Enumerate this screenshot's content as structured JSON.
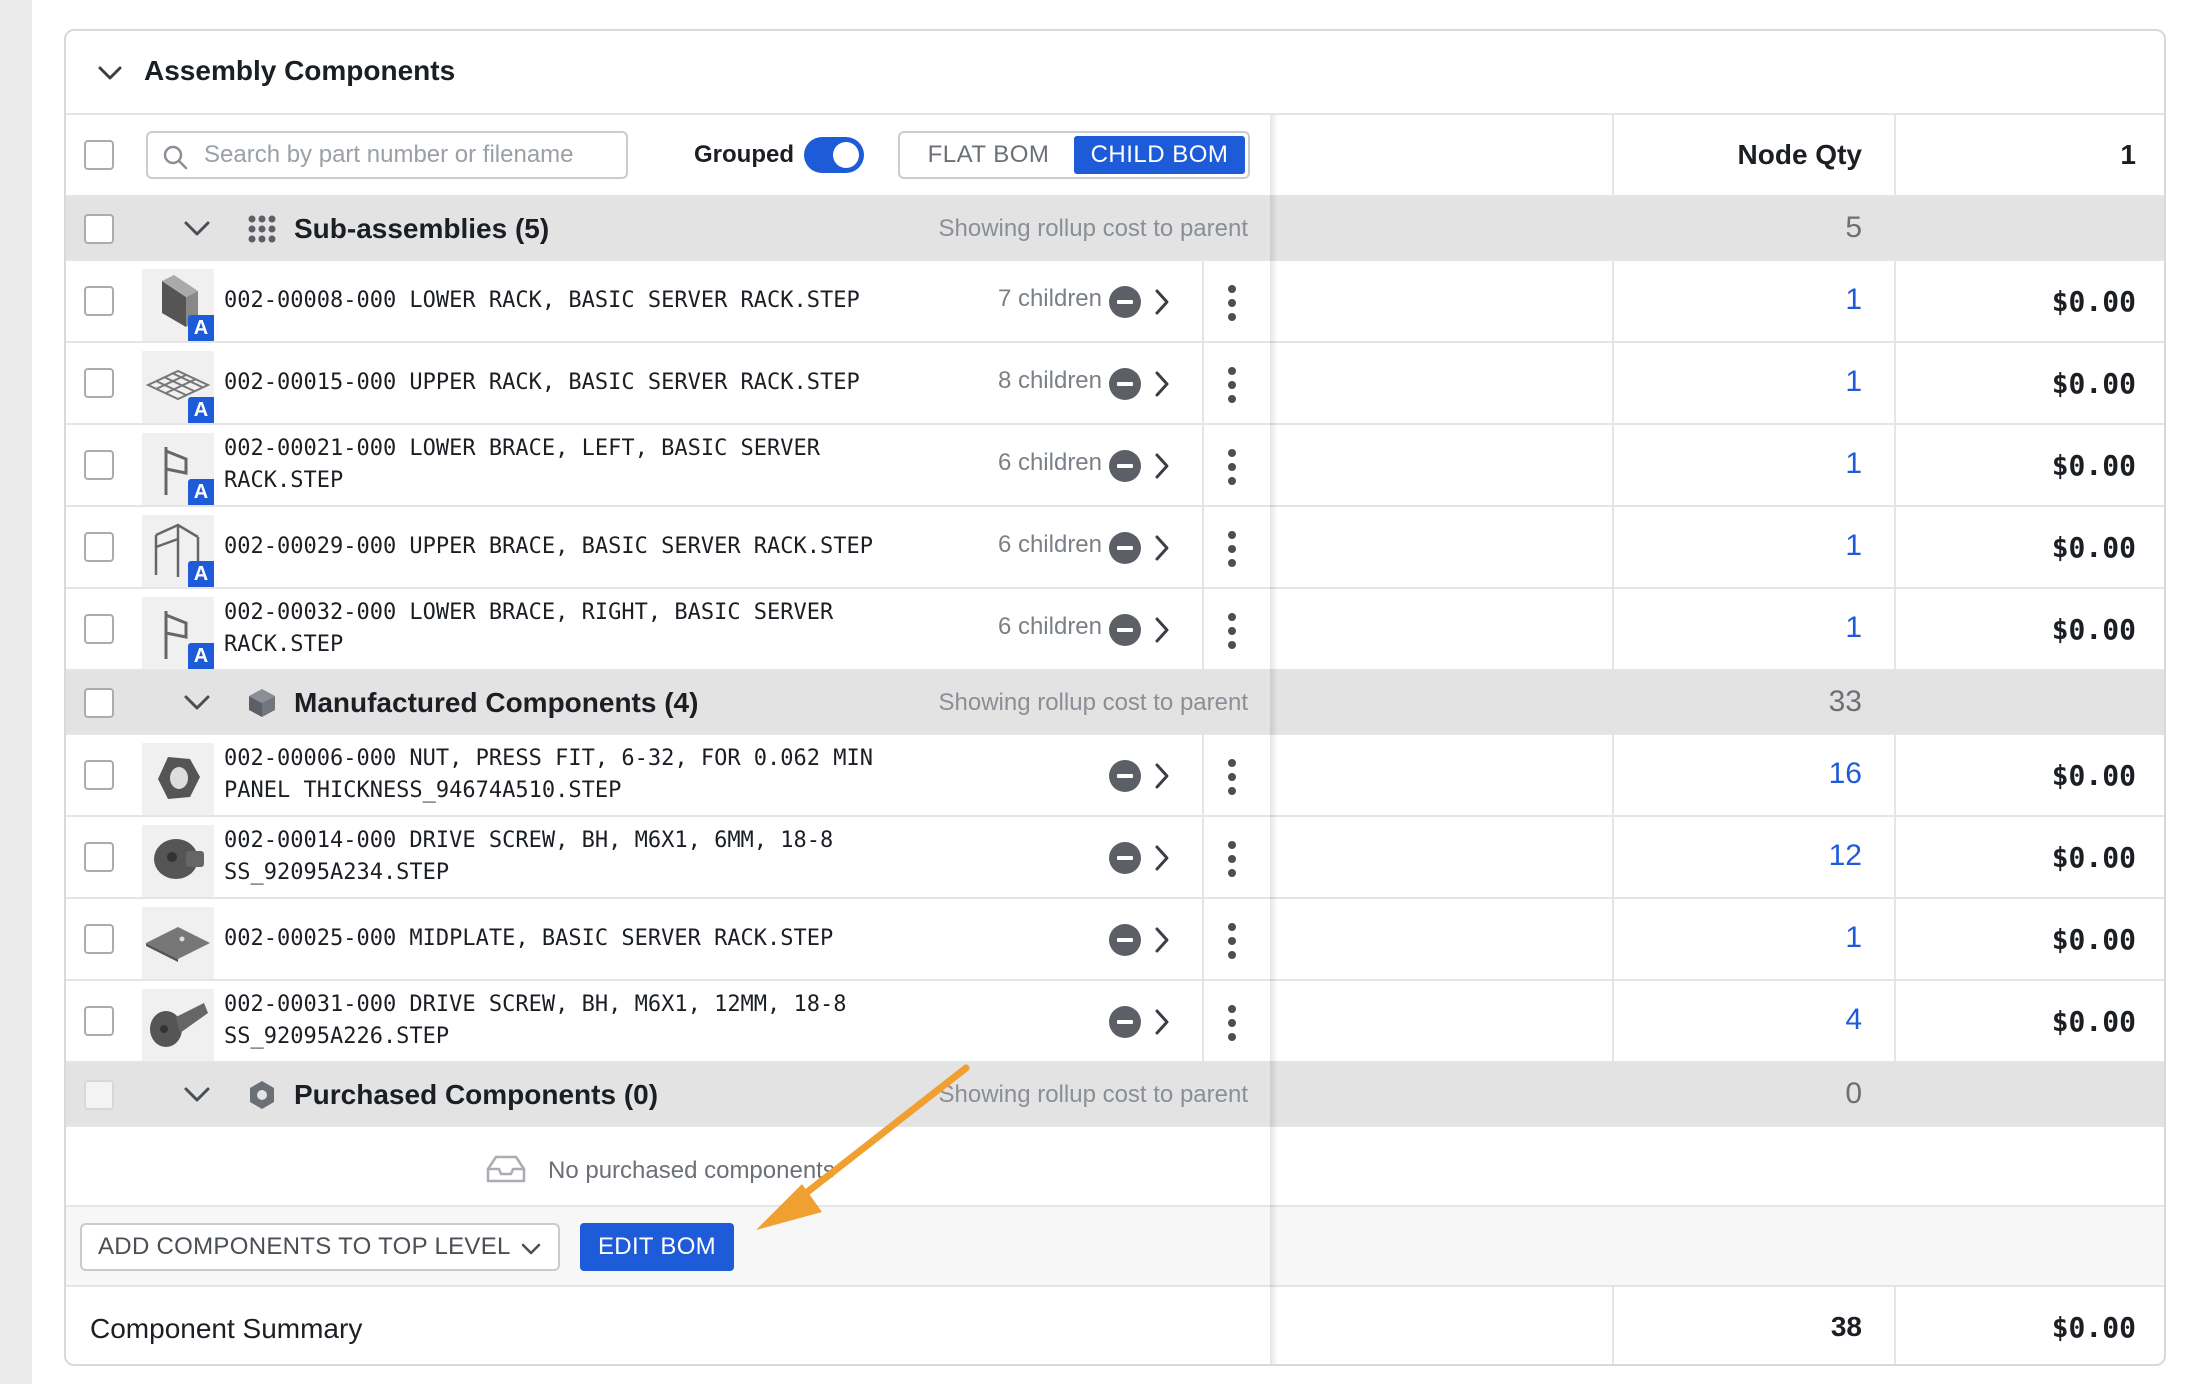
{
  "panel": {
    "title": "Assembly Components"
  },
  "toolbar": {
    "search_placeholder": "Search by part number or filename",
    "grouped_label": "Grouped",
    "grouped_on": true,
    "view_options": [
      "FLAT BOM",
      "CHILD BOM"
    ],
    "active_view": "CHILD BOM"
  },
  "right_header": {
    "label": "Node Qty",
    "value": "1"
  },
  "groups": [
    {
      "title": "Sub-assemblies (5)",
      "icon": "grid-dots-icon",
      "note": "Showing rollup cost to parent",
      "qty": "5",
      "items": [
        {
          "name": "002-00008-000 LOWER RACK, BASIC SERVER RACK.STEP",
          "children": "7 children",
          "qty": "1",
          "cost": "$0.00",
          "thumb": "lower-rack-thumbnail",
          "badge": "A"
        },
        {
          "name": "002-00015-000 UPPER RACK, BASIC SERVER RACK.STEP",
          "children": "8 children",
          "qty": "1",
          "cost": "$0.00",
          "thumb": "upper-rack-thumbnail",
          "badge": "A"
        },
        {
          "name": "002-00021-000 LOWER BRACE, LEFT, BASIC SERVER RACK.STEP",
          "children": "6 children",
          "qty": "1",
          "cost": "$0.00",
          "thumb": "brace-thumbnail",
          "badge": "A"
        },
        {
          "name": "002-00029-000 UPPER BRACE, BASIC SERVER RACK.STEP",
          "children": "6 children",
          "qty": "1",
          "cost": "$0.00",
          "thumb": "upper-brace-thumbnail",
          "badge": "A"
        },
        {
          "name": "002-00032-000 LOWER BRACE, RIGHT, BASIC SERVER RACK.STEP",
          "children": "6 children",
          "qty": "1",
          "cost": "$0.00",
          "thumb": "brace-thumbnail",
          "badge": "A"
        }
      ]
    },
    {
      "title": "Manufactured Components (4)",
      "icon": "cube-icon",
      "note": "Showing rollup cost to parent",
      "qty": "33",
      "items": [
        {
          "name": "002-00006-000 NUT, PRESS FIT, 6-32, FOR 0.062 MIN PANEL THICKNESS_94674A510.STEP",
          "children": "",
          "qty": "16",
          "cost": "$0.00",
          "thumb": "nut-thumbnail"
        },
        {
          "name": "002-00014-000 DRIVE SCREW, BH, M6X1, 6MM, 18-8 SS_92095A234.STEP",
          "children": "",
          "qty": "12",
          "cost": "$0.00",
          "thumb": "screw-thumbnail"
        },
        {
          "name": "002-00025-000 MIDPLATE, BASIC SERVER RACK.STEP",
          "children": "",
          "qty": "1",
          "cost": "$0.00",
          "thumb": "midplate-thumbnail"
        },
        {
          "name": "002-00031-000 DRIVE SCREW, BH, M6X1, 12MM, 18-8 SS_92095A226.STEP",
          "children": "",
          "qty": "4",
          "cost": "$0.00",
          "thumb": "long-screw-thumbnail"
        }
      ]
    },
    {
      "title": "Purchased Components (0)",
      "icon": "hexagon-icon",
      "note": "Showing rollup cost to parent",
      "qty": "0",
      "items": []
    }
  ],
  "empty_state": {
    "text": "No purchased components",
    "icon": "inbox-icon"
  },
  "actions": {
    "add_label": "ADD COMPONENTS TO TOP LEVEL",
    "edit_label": "EDIT BOM"
  },
  "summary": {
    "label": "Component Summary",
    "qty": "38",
    "cost": "$0.00"
  },
  "colors": {
    "accent": "#1e5bd8",
    "annotation_arrow": "#f0a030",
    "group_bg": "#e3e3e3"
  }
}
